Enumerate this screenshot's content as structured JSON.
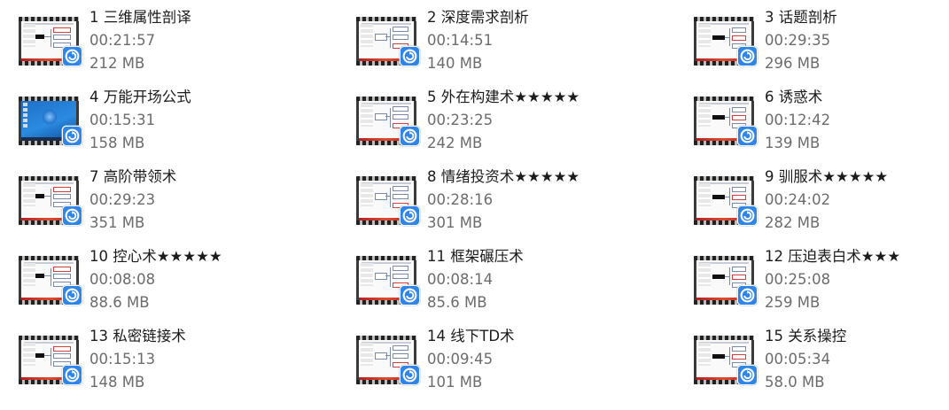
{
  "files": [
    {
      "name": "1 三维属性剖译",
      "duration": "00:21:57",
      "size": "212 MB",
      "thumb": "mindmap"
    },
    {
      "name": "2 深度需求剖析",
      "duration": "00:14:51",
      "size": "140 MB",
      "thumb": "mindmap"
    },
    {
      "name": "3 话题剖析",
      "duration": "00:29:35",
      "size": "296 MB",
      "thumb": "mindmap"
    },
    {
      "name": "4 万能开场公式",
      "duration": "00:15:31",
      "size": "158 MB",
      "thumb": "desktop"
    },
    {
      "name": "5 外在构建术★★★★★",
      "duration": "00:23:25",
      "size": "242 MB",
      "thumb": "mindmap"
    },
    {
      "name": "6 诱惑术",
      "duration": "00:12:42",
      "size": "139 MB",
      "thumb": "mindmap"
    },
    {
      "name": "7 高阶带领术",
      "duration": "00:29:23",
      "size": "351 MB",
      "thumb": "mindmap"
    },
    {
      "name": "8 情绪投资术★★★★★",
      "duration": "00:28:16",
      "size": "301 MB",
      "thumb": "mindmap"
    },
    {
      "name": "9 驯服术★★★★★",
      "duration": "00:24:02",
      "size": "282 MB",
      "thumb": "mindmap"
    },
    {
      "name": "10 控心术★★★★★",
      "duration": "00:08:08",
      "size": "88.6 MB",
      "thumb": "mindmap"
    },
    {
      "name": "11 框架碾压术",
      "duration": "00:08:14",
      "size": "85.6 MB",
      "thumb": "mindmap"
    },
    {
      "name": "12 压迫表白术★★★",
      "duration": "00:25:08",
      "size": "259 MB",
      "thumb": "mindmap"
    },
    {
      "name": "13 私密链接术",
      "duration": "00:15:13",
      "size": "148 MB",
      "thumb": "mindmap"
    },
    {
      "name": "14 线下TD术",
      "duration": "00:09:45",
      "size": "101 MB",
      "thumb": "mindmap"
    },
    {
      "name": "15 关系操控",
      "duration": "00:05:34",
      "size": "58.0 MB",
      "thumb": "mindmap"
    }
  ],
  "icons": {
    "badge": "video-player-badge-icon",
    "thumbnail": "video-thumbnail"
  },
  "colors": {
    "badge": "#2f86e8",
    "name_text": "#1b1b1b",
    "meta_text": "#6c6c6c"
  }
}
